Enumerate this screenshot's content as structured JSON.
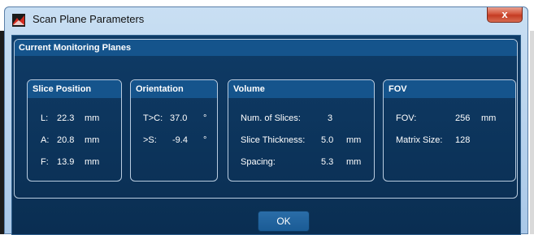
{
  "window": {
    "title": "Scan Plane Parameters",
    "close_glyph": "x"
  },
  "group": {
    "title": "Current Monitoring Planes"
  },
  "slice_position": {
    "title": "Slice Position",
    "rows": [
      {
        "axis": "L:",
        "value": "22.3",
        "unit": "mm"
      },
      {
        "axis": "A:",
        "value": "20.8",
        "unit": "mm"
      },
      {
        "axis": "F:",
        "value": "13.9",
        "unit": "mm"
      }
    ]
  },
  "orientation": {
    "title": "Orientation",
    "rows": [
      {
        "axis": "T>C:",
        "value": "37.0",
        "unit": "°"
      },
      {
        "axis": ">S:",
        "value": "-9.4",
        "unit": "°"
      }
    ]
  },
  "volume": {
    "title": "Volume",
    "rows": [
      {
        "label": "Num. of Slices:",
        "value": "3",
        "unit": ""
      },
      {
        "label": "Slice Thickness:",
        "value": "5.0",
        "unit": "mm"
      },
      {
        "label": "Spacing:",
        "value": "5.3",
        "unit": "mm"
      }
    ]
  },
  "fov": {
    "title": "FOV",
    "rows": [
      {
        "label": "FOV:",
        "value": "256",
        "unit": "mm"
      },
      {
        "label": "Matrix Size:",
        "value": "128",
        "unit": ""
      }
    ]
  },
  "buttons": {
    "ok": "OK"
  },
  "icons": {
    "app": "app-logo-icon",
    "close": "close-icon"
  }
}
